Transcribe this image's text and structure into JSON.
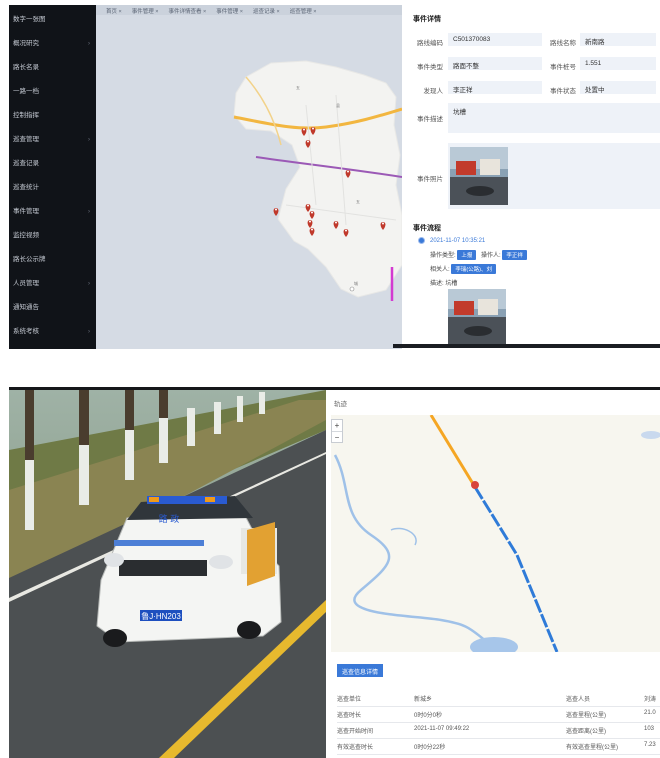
{
  "sidebar": {
    "items": [
      {
        "label": "数字一张图",
        "has_children": false
      },
      {
        "label": "概况研究",
        "has_children": true
      },
      {
        "label": "路长名录",
        "has_children": false
      },
      {
        "label": "一路一档",
        "has_children": false
      },
      {
        "label": "控制指挥",
        "has_children": false
      },
      {
        "label": "巡查管理",
        "has_children": true
      },
      {
        "label": "巡查记录",
        "has_children": false
      },
      {
        "label": "巡查统计",
        "has_children": false
      },
      {
        "label": "事件管理",
        "has_children": true
      },
      {
        "label": "监控视频",
        "has_children": false
      },
      {
        "label": "路长公示牌",
        "has_children": false
      },
      {
        "label": "人员管理",
        "has_children": true
      },
      {
        "label": "通知通告",
        "has_children": false
      },
      {
        "label": "系统考核",
        "has_children": true
      }
    ]
  },
  "map_toolbar": {
    "items": [
      "首页 ×",
      "事件管理 ×",
      "事件详情查看 ×",
      "事件管理 ×",
      "巡查记录 ×",
      "巡查管理 ×"
    ]
  },
  "event_detail": {
    "section_title": "事件详情",
    "fields": {
      "road_code_label": "路线编码",
      "road_code_value": "C501370083",
      "road_name_label": "路线名称",
      "road_name_value": "新南路",
      "event_type_label": "事件类型",
      "event_type_value": "路面不整",
      "stake_label": "事件桩号",
      "stake_value": "1.551",
      "reporter_label": "发现人",
      "reporter_value": "李正祥",
      "status_label": "事件状态",
      "status_value": "处置中",
      "desc_label": "事件描述",
      "desc_value": "坑槽",
      "photo_label": "事件照片"
    }
  },
  "process": {
    "section_title": "事件流程",
    "entry": {
      "time": "2021-11-07 10:35:21",
      "op_type_label": "操作类型:",
      "op_type_value": "上报",
      "operator_label": "操作人:",
      "operator_value": "李正祥",
      "related_label": "相关人:",
      "related_value": "李瑞(公路)、刘",
      "remark": "描述: 坑槽"
    }
  },
  "bottom_map": {
    "title": "轨迹",
    "zoom_in": "+",
    "zoom_out": "−",
    "info_button": "巡查信息详情"
  },
  "inspection_info": {
    "rows": [
      [
        "巡查单位",
        "新城乡",
        "巡查人员",
        "刘涛"
      ],
      [
        "巡查时长",
        "0时0分0秒",
        "巡查里程(公里)",
        "21.0"
      ],
      [
        "巡查开始时间",
        "2021-11-07 09:49:22",
        "巡查距离(公里)",
        "103"
      ],
      [
        "有效巡查时长",
        "0时0分22秒",
        "有效巡查里程(公里)",
        "7.23"
      ],
      [
        "",
        "",
        "",
        ""
      ]
    ]
  },
  "car": {
    "plate": "鲁J·HN203",
    "door_text": "路 政"
  },
  "colors": {
    "accent": "#3a79d8",
    "sidebar_bg": "#101318",
    "road_route": "#9b59b6",
    "road_orange": "#f5a623",
    "marker": "#c0392b",
    "track": "#2f7bd8"
  }
}
